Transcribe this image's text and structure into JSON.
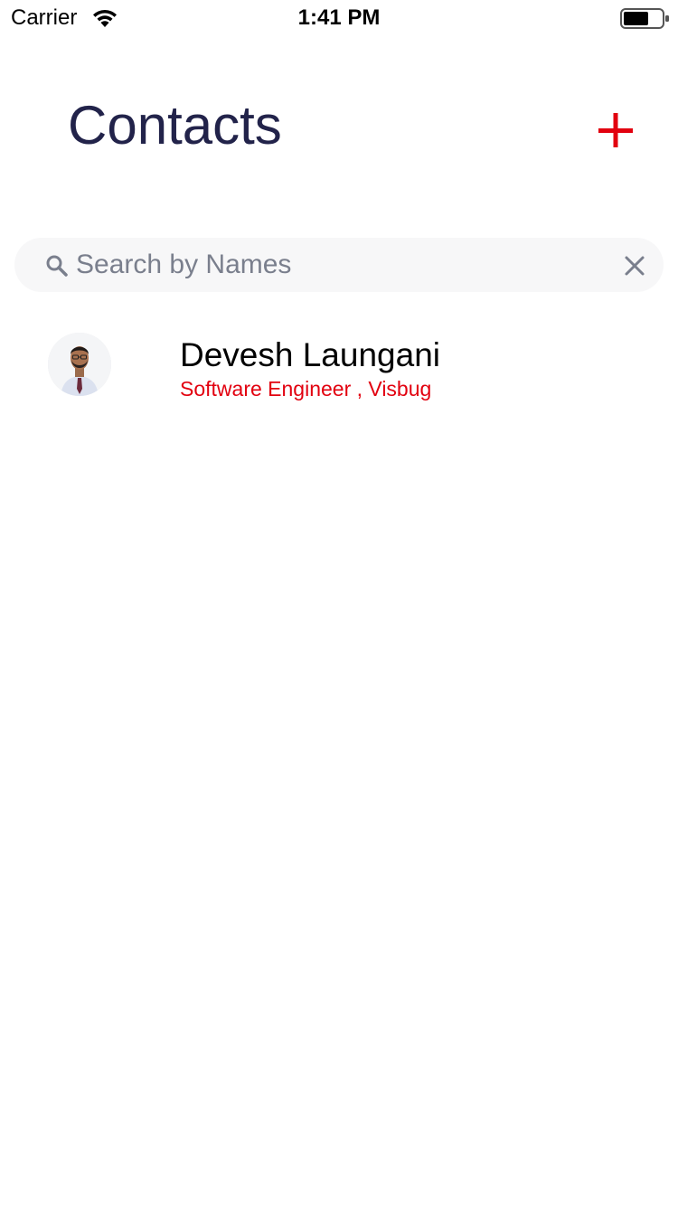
{
  "status_bar": {
    "carrier": "Carrier",
    "time": "1:41 PM",
    "wifi_icon": "wifi-icon",
    "battery_icon": "battery-icon"
  },
  "header": {
    "title": "Contacts",
    "add_icon": "plus-icon",
    "accent_color": "#e2000f",
    "title_color": "#22234a"
  },
  "search": {
    "placeholder": "Search by Names",
    "value": "",
    "search_icon": "search-icon",
    "clear_icon": "close-icon"
  },
  "contacts": [
    {
      "name": "Devesh Laungani",
      "subtitle": "Software Engineer , Visbug",
      "avatar_icon": "avatar"
    }
  ]
}
